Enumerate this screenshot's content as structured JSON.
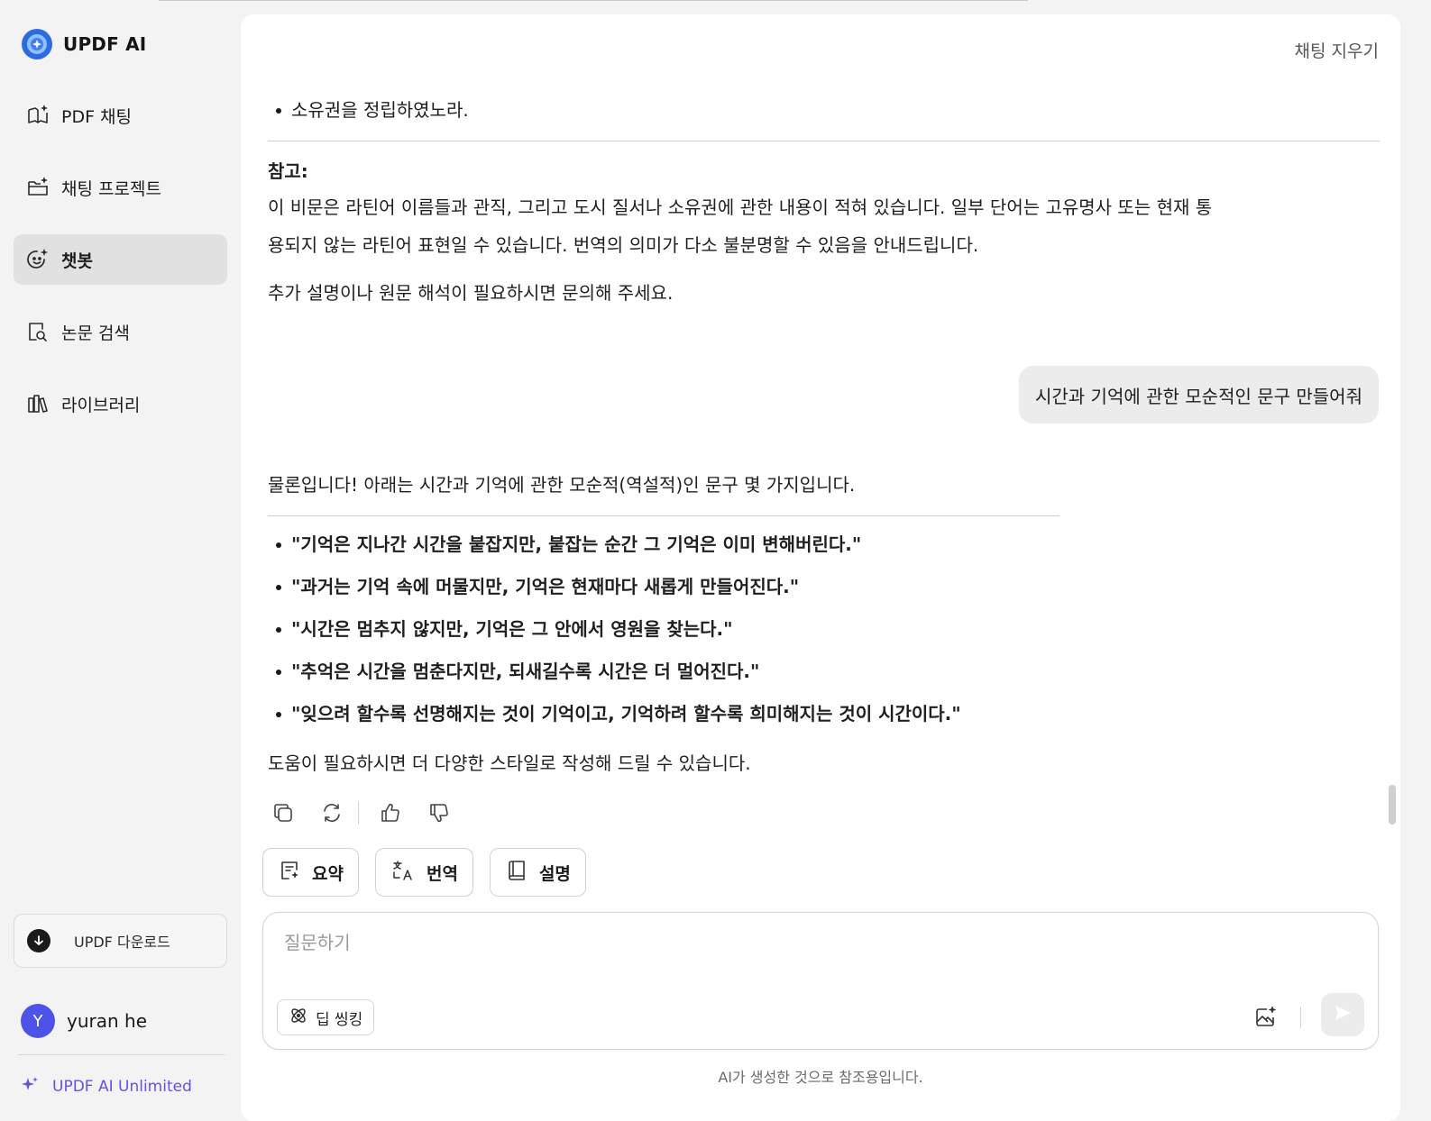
{
  "brand": {
    "name": "UPDF AI",
    "logo_icon": "updf-ai-logo-icon"
  },
  "sidebar": {
    "items": [
      {
        "label": "PDF 채팅",
        "icon": "book-sparkle-icon",
        "active": false
      },
      {
        "label": "채팅 프로젝트",
        "icon": "folder-sparkle-icon",
        "active": false
      },
      {
        "label": "챗봇",
        "icon": "chatbot-face-icon",
        "active": true
      },
      {
        "label": "논문 검색",
        "icon": "document-search-icon",
        "active": false
      },
      {
        "label": "라이브러리",
        "icon": "library-books-icon",
        "active": false
      }
    ],
    "download": {
      "label": "UPDF 다운로드",
      "icon": "download-circle-icon"
    },
    "user": {
      "initial": "Y",
      "name": "yuran he"
    },
    "unlimited": {
      "label": "UPDF AI Unlimited",
      "icon": "sparkle-icon",
      "color": "#6b4fe0"
    }
  },
  "header": {
    "clear_label": "채팅 지우기"
  },
  "conversation": {
    "prev_bullet": "소유권을 정립하였노라.",
    "note_title": "참고:",
    "note_body_line1": "이 비문은 라틴어 이름들과 관직, 그리고 도시 질서나 소유권에 관한 내용이 적혀 있습니다. 일부 단어는 고유명사 또는 현재 통",
    "note_body_line2": "용되지 않는 라틴어 표현일 수 있습니다. 번역의 의미가 다소 불분명할 수 있음을 안내드립니다.",
    "followup": "추가 설명이나 원문 해석이 필요하시면 문의해 주세요.",
    "user_message": "시간과 기억에 관한 모순적인 문구 만들어줘",
    "reply_intro": "물론입니다! 아래는 시간과 기억에 관한 모순적(역설적)인 문구 몇 가지입니다.",
    "quotes": [
      "\"기억은 지나간 시간을 붙잡지만, 붙잡는 순간 그 기억은 이미 변해버린다.\"",
      "\"과거는 기억 속에 머물지만, 기억은 현재마다 새롭게 만들어진다.\"",
      "\"시간은 멈추지 않지만, 기억은 그 안에서 영원을 찾는다.\"",
      "\"추억은 시간을 멈춘다지만, 되새길수록 시간은 더 멀어진다.\"",
      "\"잊으려 할수록 선명해지는 것이 기억이고, 기억하려 할수록 희미해지는 것이 시간이다.\""
    ],
    "reply_outro": "도움이 필요하시면 더 다양한 스타일로 작성해 드릴 수 있습니다."
  },
  "actions": {
    "copy_icon": "copy-icon",
    "regenerate_icon": "regenerate-icon",
    "like_icon": "thumbs-up-icon",
    "dislike_icon": "thumbs-down-icon"
  },
  "chips": [
    {
      "label": "요약",
      "icon": "summary-icon"
    },
    {
      "label": "번역",
      "icon": "translate-icon"
    },
    {
      "label": "설명",
      "icon": "book-icon"
    }
  ],
  "composer": {
    "placeholder": "질문하기",
    "value": "",
    "deep_thinking_label": "딥 씽킹",
    "image_icon": "image-sparkle-icon",
    "send_icon": "send-icon"
  },
  "disclaimer": "AI가 생성한 것으로 참조용입니다."
}
